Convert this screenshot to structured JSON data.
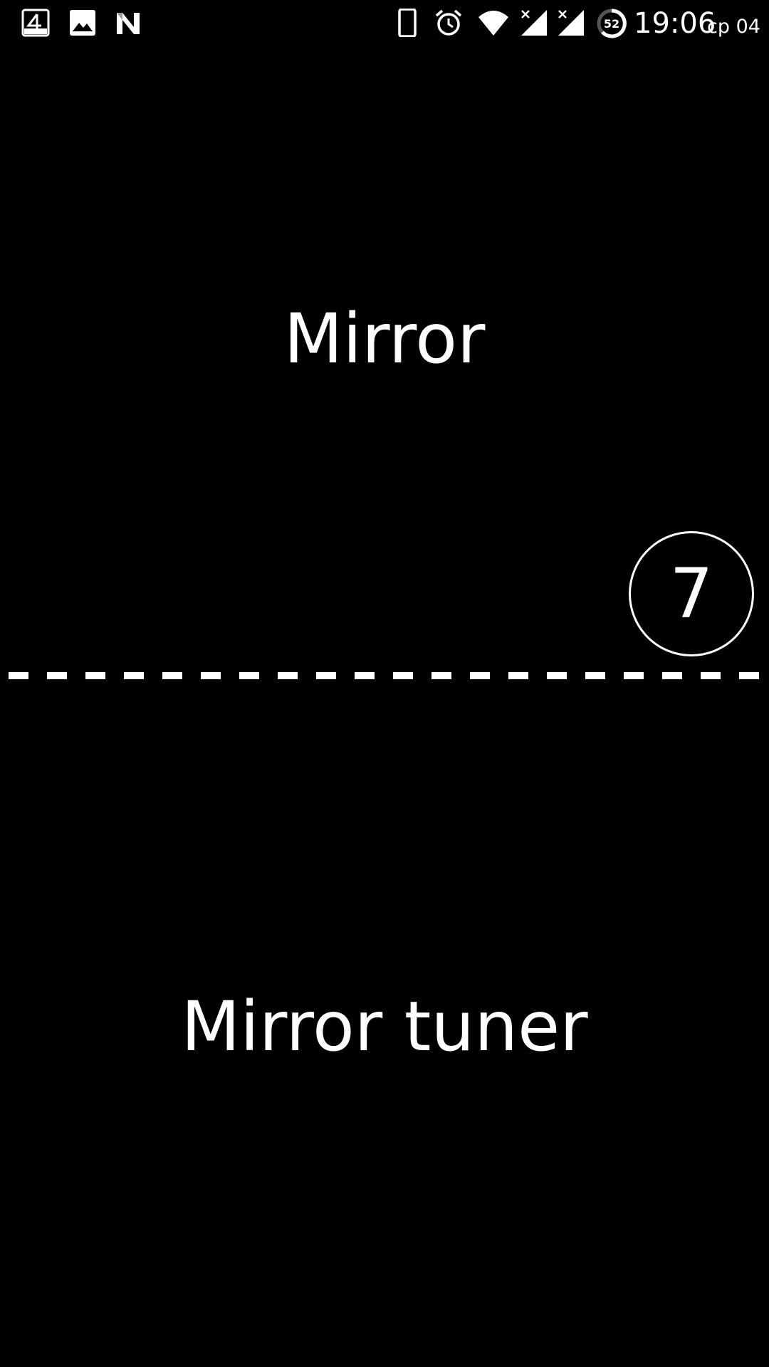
{
  "status_bar": {
    "left_icons": [
      "notification-4-icon",
      "gallery-icon",
      "n-logo-icon"
    ],
    "right_icons": [
      "phone-icon",
      "alarm-icon",
      "wifi-icon",
      "signal-1-icon",
      "signal-2-icon",
      "battery-icon"
    ],
    "battery_level": "52",
    "time": "19:06",
    "date": "ср 04"
  },
  "main": {
    "title": "Mirror",
    "countdown": "7",
    "tuner_title": "Mirror tuner"
  },
  "colors": {
    "background": "#000000",
    "foreground": "#ffffff"
  }
}
